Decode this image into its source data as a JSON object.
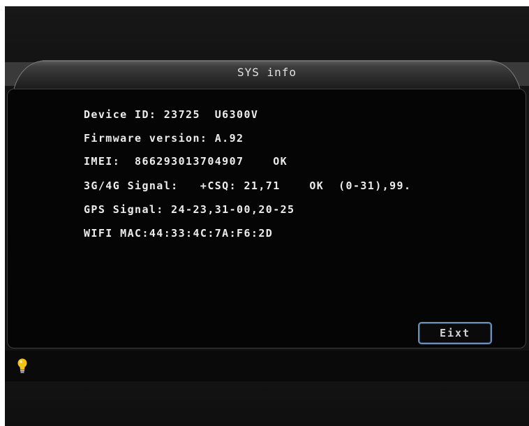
{
  "window": {
    "title": "SYS info"
  },
  "info": {
    "device_id": "Device ID: 23725  U6300V",
    "firmware": "Firmware version: A.92",
    "imei": "IMEI:  866293013704907    OK",
    "signal": "3G/4G Signal:   +CSQ: 21,71    OK  (0-31),99.",
    "gps": "GPS Signal: 24-23,31-00,20-25",
    "wifi": "WIFI MAC:44:33:4C:7A:F6:2D"
  },
  "buttons": {
    "exit_label": "Eixt"
  },
  "icons": {
    "status": "lightbulb-icon"
  },
  "colors": {
    "button_border": "#6c8fb8",
    "bulb": "#f6c21a",
    "text": "#ececec"
  }
}
